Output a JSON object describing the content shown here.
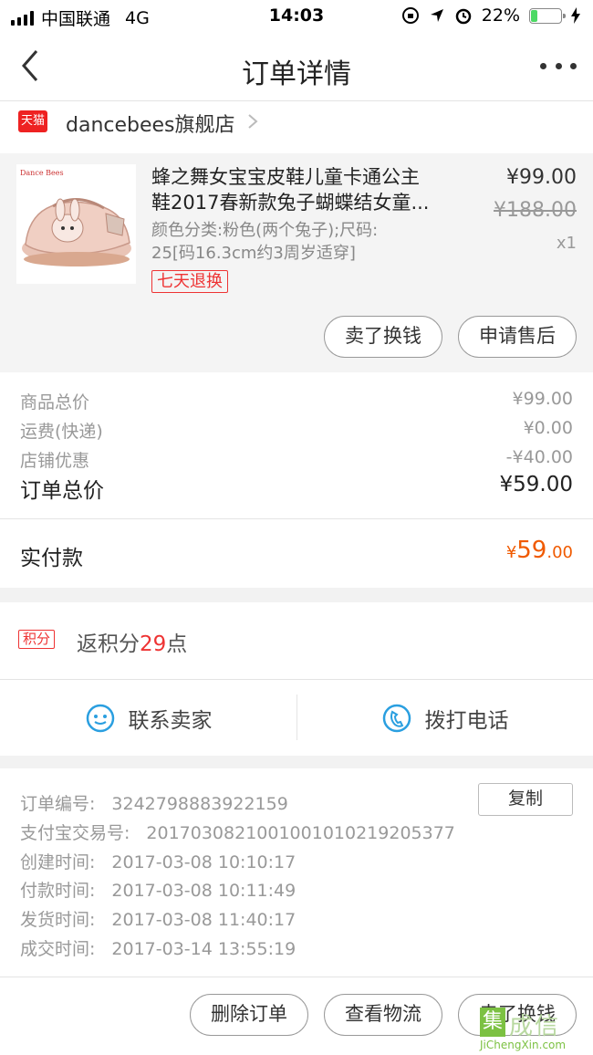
{
  "status": {
    "carrier": "中国联通",
    "network": "4G",
    "time": "14:03",
    "battery": "22%",
    "battery_level": 0.22
  },
  "nav": {
    "title": "订单详情"
  },
  "shop": {
    "badge": "天猫",
    "name": "dancebees旗舰店"
  },
  "product": {
    "image_brand": "Dance Bees",
    "title_line1": "蜂之舞女宝宝皮鞋儿童卡通公主",
    "title_line2": "鞋2017春新款兔子蝴蝶结女童...",
    "spec_line1": "颜色分类:粉色(两个兔子);尺码:",
    "spec_line2": "25[码16.3cm约3周岁适穿]",
    "price": "¥99.00",
    "original_price": "¥188.00",
    "quantity": "x1",
    "return_tag": "七天退换",
    "btn_sell": "卖了换钱",
    "btn_aftersale": "申请售后"
  },
  "summary": {
    "rows": [
      {
        "label": "商品总价",
        "value": "¥99.00"
      },
      {
        "label": "运费(快递)",
        "value": "¥0.00"
      },
      {
        "label": "店铺优惠",
        "value": "-¥40.00"
      }
    ],
    "total_label": "订单总价",
    "total_value": "¥59.00",
    "paid_label": "实付款",
    "paid_currency": "¥",
    "paid_int": "59",
    "paid_dec": ".00"
  },
  "points": {
    "tag": "积分",
    "prefix": "返积分",
    "value": "29",
    "suffix": "点"
  },
  "contact": {
    "seller": "联系卖家",
    "phone": "拨打电话"
  },
  "info": {
    "rows": [
      {
        "label": "订单编号:",
        "value": "3242798883922159"
      },
      {
        "label": "支付宝交易号:",
        "value": "2017030821001001010219205377"
      },
      {
        "label": "创建时间:",
        "value": "2017-03-08 10:10:17"
      },
      {
        "label": "付款时间:",
        "value": "2017-03-08 10:11:49"
      },
      {
        "label": "发货时间:",
        "value": "2017-03-08 11:40:17"
      },
      {
        "label": "成交时间:",
        "value": "2017-03-14 13:55:19"
      }
    ],
    "copy_label": "复制"
  },
  "footer": {
    "delete": "删除订单",
    "logistics": "查看物流",
    "sell": "卖了换钱"
  },
  "watermark": {
    "box": "集",
    "text": "成信",
    "url": "JiChengXin.com"
  },
  "colors": {
    "accent": "#f05a00",
    "tmall_red": "#e22",
    "points_red": "#e33",
    "icon_blue": "#2a9fe0"
  }
}
